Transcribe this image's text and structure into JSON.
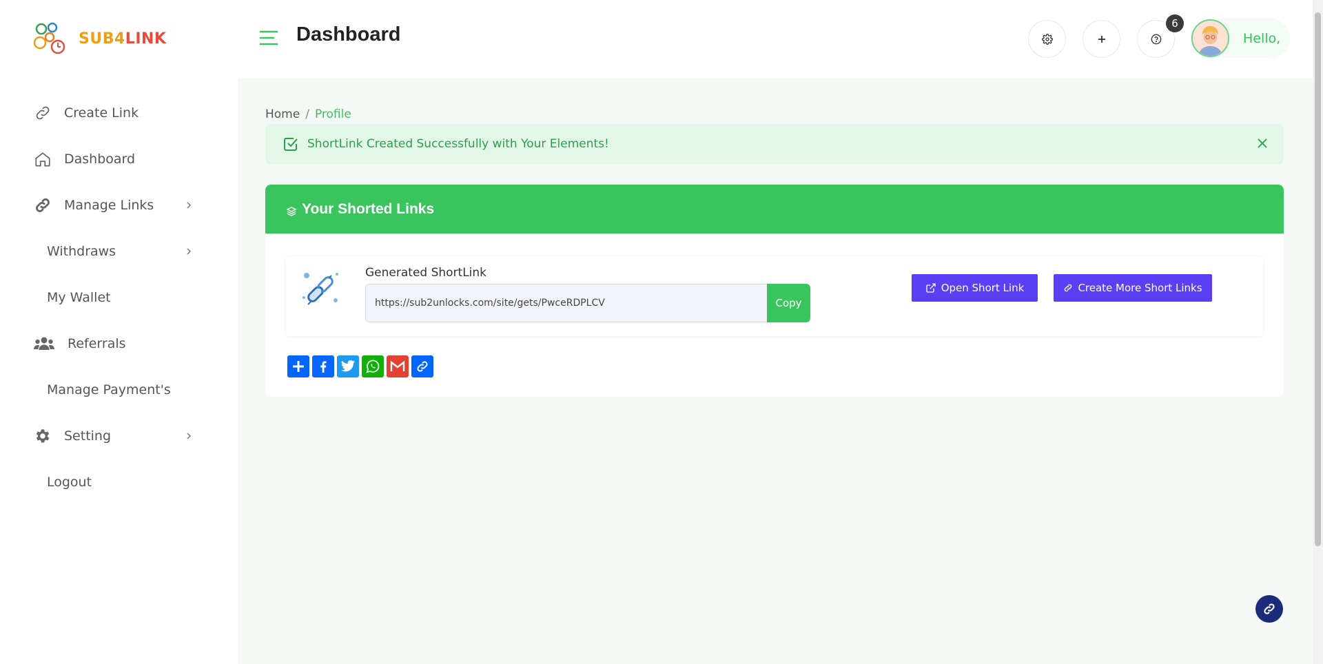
{
  "brand": {
    "logo_part1": "SUB4",
    "logo_part2": "LINK"
  },
  "sidebar": {
    "items": [
      {
        "label": "Create Link"
      },
      {
        "label": "Dashboard"
      },
      {
        "label": "Manage Links"
      },
      {
        "label": "Withdraws"
      },
      {
        "label": "My Wallet"
      },
      {
        "label": "Referrals"
      },
      {
        "label": "Manage Payment's"
      },
      {
        "label": "Setting"
      },
      {
        "label": "Logout"
      }
    ]
  },
  "header": {
    "title": "Dashboard",
    "notification_count": "6",
    "greeting": "Hello,"
  },
  "breadcrumb": {
    "home": "Home",
    "separator": "/",
    "current": "Profile"
  },
  "alert": {
    "message": "ShortLink Created Successfully with Your Elements!"
  },
  "card": {
    "title": "Your Shorted Links",
    "generated_label": "Generated ShortLink",
    "short_url": "https://sub2unlocks.com/site/gets/PwceRDPLCV",
    "copy_label": "Copy",
    "open_label": "Open Short Link",
    "create_more_label": "Create More Short Links"
  },
  "share": {
    "buttons": [
      "add-share-icon",
      "facebook-icon",
      "twitter-icon",
      "whatsapp-icon",
      "gmail-icon",
      "copy-link-icon"
    ]
  },
  "colors": {
    "accent": "#3ac45e",
    "primary_button": "#5a3ff5",
    "fab": "#1c2a7a"
  }
}
